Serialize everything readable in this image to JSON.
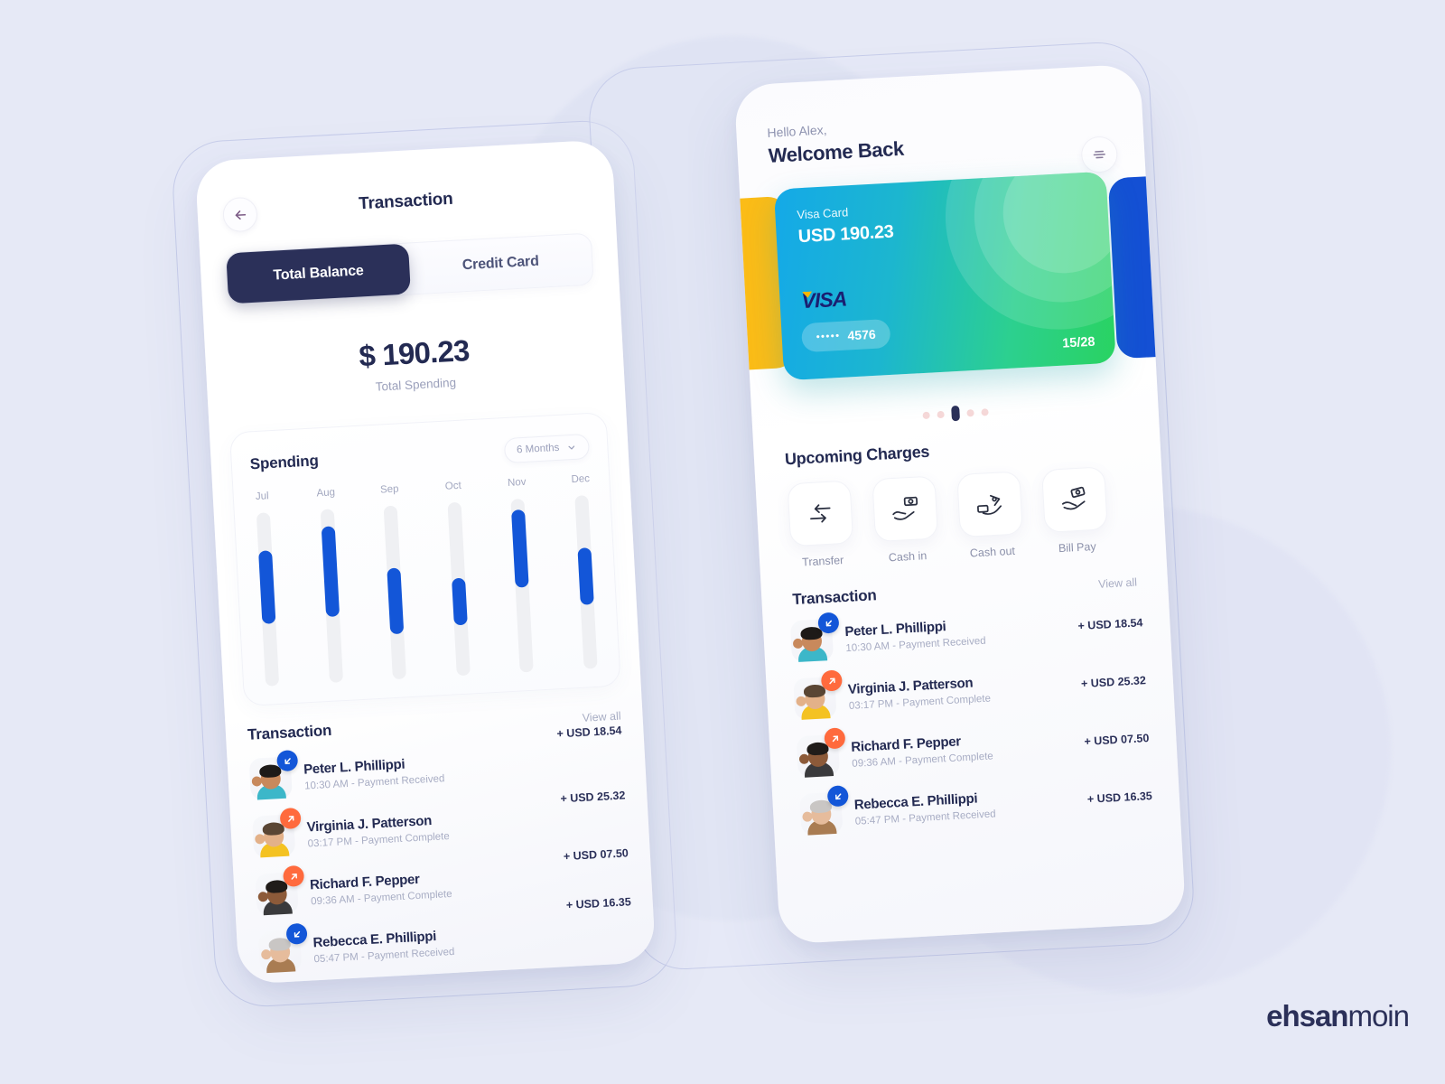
{
  "theme": {
    "background": "#e6e9f6",
    "navy": "#232a52",
    "navy_dark": "#2b3059",
    "blue": "#1356d8",
    "orange": "#ff6a3d",
    "muted": "#a8adc4",
    "card_gradient_from": "#14a9e8",
    "card_gradient_to": "#29d361",
    "side_card_yellow": "#fbbc17",
    "side_card_blue": "#1450d4"
  },
  "watermark": {
    "bold": "ehsan",
    "light": "moin"
  },
  "left_screen": {
    "back_icon": "arrow-left-icon",
    "title": "Transaction",
    "tabs": [
      {
        "label": "Total Balance",
        "active": true
      },
      {
        "label": "Credit Card",
        "active": false
      }
    ],
    "balance": {
      "amount": "$ 190.23",
      "label": "Total Spending"
    },
    "spending": {
      "title": "Spending",
      "range_label": "6 Months",
      "range_icon": "chevron-down-icon"
    },
    "transactions_header": {
      "title": "Transaction",
      "view_all": "View all"
    },
    "transactions": [
      {
        "name": "Peter L. Phillippi",
        "time": "10:30 AM",
        "status": "Payment Received",
        "amount": "+ USD 18.54",
        "direction": "in"
      },
      {
        "name": "Virginia J. Patterson",
        "time": "03:17 PM",
        "status": "Payment Complete",
        "amount": "+ USD 25.32",
        "direction": "out"
      },
      {
        "name": "Richard F. Pepper",
        "time": "09:36 AM",
        "status": "Payment Complete",
        "amount": "+ USD 07.50",
        "direction": "out"
      },
      {
        "name": "Rebecca E. Phillippi",
        "time": "05:47 PM",
        "status": "Payment Received",
        "amount": "+ USD 16.35",
        "direction": "in"
      }
    ]
  },
  "right_screen": {
    "greeting_line1": "Hello Alex,",
    "greeting_line2": "Welcome Back",
    "menu_icon": "filter-settings-icon",
    "card": {
      "type_label": "Visa Card",
      "amount": "USD 190.23",
      "brand": "VISA",
      "masked_digits": "•••••",
      "last4": "4576",
      "expiry": "15/28"
    },
    "carousel": {
      "count": 5,
      "active_index": 2
    },
    "upcoming_title": "Upcoming Charges",
    "quick_actions": [
      {
        "label": "Transfer",
        "icon": "transfer-arrows-icon"
      },
      {
        "label": "Cash in",
        "icon": "hand-receiving-cash-icon"
      },
      {
        "label": "Cash out",
        "icon": "hand-giving-cash-icon"
      },
      {
        "label": "Bill Pay",
        "icon": "hand-bills-icon"
      }
    ],
    "transactions_header": {
      "title": "Transaction",
      "view_all": "View all"
    },
    "transactions": [
      {
        "name": "Peter L. Phillippi",
        "time": "10:30 AM",
        "status": "Payment Received",
        "amount": "+ USD 18.54",
        "direction": "in"
      },
      {
        "name": "Virginia J. Patterson",
        "time": "03:17 PM",
        "status": "Payment Complete",
        "amount": "+ USD 25.32",
        "direction": "out"
      },
      {
        "name": "Richard F. Pepper",
        "time": "09:36 AM",
        "status": "Payment Complete",
        "amount": "+ USD 07.50",
        "direction": "out"
      },
      {
        "name": "Rebecca E. Phillippi",
        "time": "05:47 PM",
        "status": "Payment Received",
        "amount": "+ USD 16.35",
        "direction": "in"
      }
    ]
  },
  "chart_data": {
    "type": "bar",
    "title": "Spending",
    "xlabel": "",
    "ylabel": "",
    "categories": [
      "Jul",
      "Aug",
      "Sep",
      "Oct",
      "Nov",
      "Dec"
    ],
    "values": [
      42,
      52,
      38,
      27,
      45,
      33
    ],
    "bar_offsets_pct": [
      22,
      10,
      36,
      44,
      6,
      30
    ],
    "track_color": "#eff0f3",
    "bar_color": "#1356d8",
    "grid": false,
    "legend": "none",
    "ylim": [
      0,
      100
    ],
    "note": "Floating range bars: values are segment lengths in % of track; bar_offsets_pct are distances from track top."
  }
}
